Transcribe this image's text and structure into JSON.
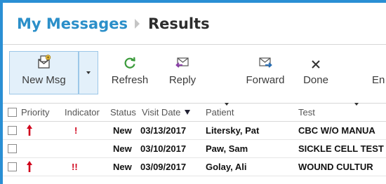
{
  "breadcrumb": {
    "root": "My Messages",
    "current": "Results"
  },
  "toolbar": {
    "new_msg": "New Msg",
    "refresh": "Refresh",
    "reply": "Reply",
    "forward": "Forward",
    "done": "Done",
    "more": "En"
  },
  "columns": {
    "priority": "Priority",
    "indicator": "Indicator",
    "status": "Status",
    "visit_date": "Visit Date",
    "patient": "Patient",
    "test": "Test"
  },
  "rows": [
    {
      "priority_icon": "up-arrow",
      "indicator": "!",
      "status": "New",
      "visit_date": "03/13/2017",
      "patient": "Litersky, Pat",
      "test": "CBC W/O MANUA"
    },
    {
      "priority_icon": "",
      "indicator": "",
      "status": "New",
      "visit_date": "03/10/2017",
      "patient": "Paw, Sam",
      "test": "SICKLE CELL TEST"
    },
    {
      "priority_icon": "up-arrow",
      "indicator": "!!",
      "status": "New",
      "visit_date": "03/09/2017",
      "patient": "Golay, Ali",
      "test": "WOUND CULTUR"
    }
  ],
  "colors": {
    "brand": "#2b8fc9",
    "border_frame": "#2a8fd4",
    "alert": "#d0021b",
    "refresh": "#3a9a3a",
    "reply": "#8a3fa8",
    "forward": "#2b6fb4"
  }
}
